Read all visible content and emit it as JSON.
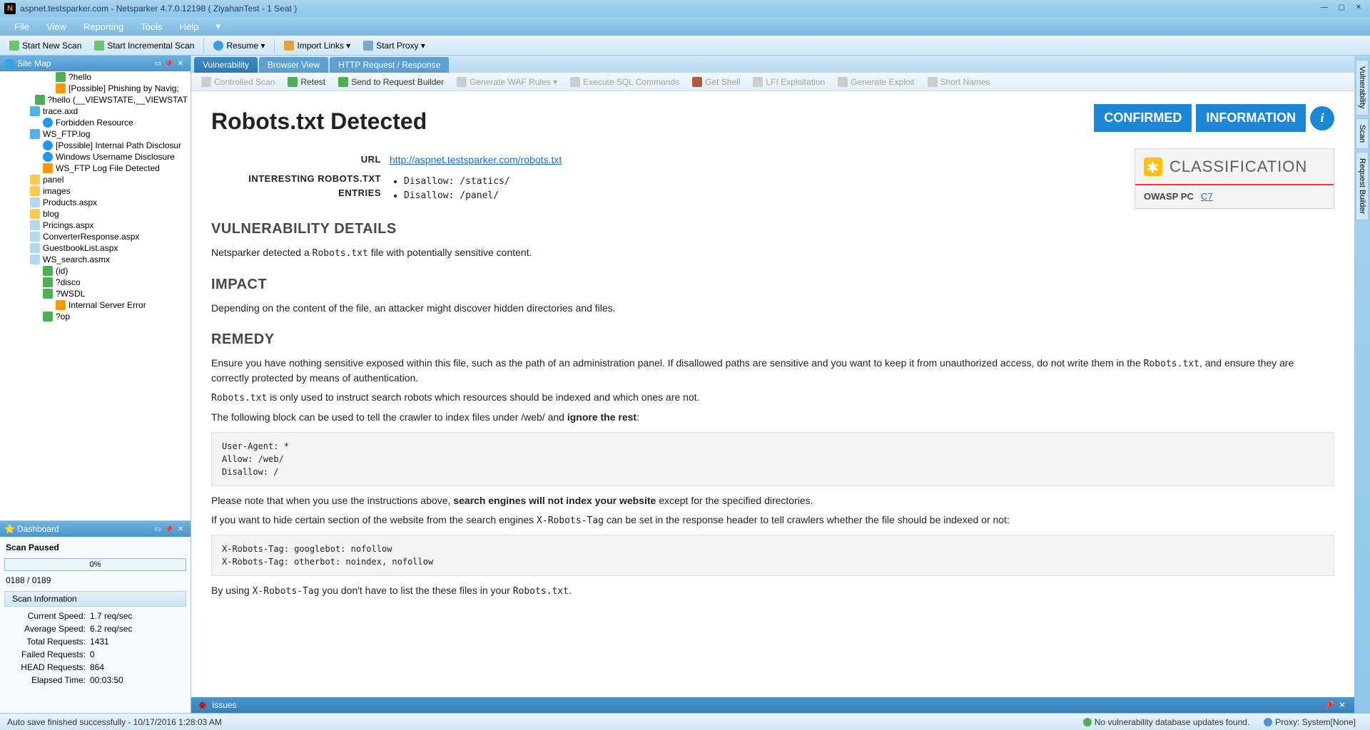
{
  "titlebar": {
    "host": "aspnet.testsparker.com",
    "app": "Netsparker 4.7.0.12198  ( ZiyahanTest - 1 Seat )"
  },
  "menu": {
    "items": [
      "File",
      "View",
      "Reporting",
      "Tools",
      "Help"
    ]
  },
  "toolbar": {
    "start_new_scan": "Start New Scan",
    "start_incremental_scan": "Start Incremental Scan",
    "resume": "Resume",
    "import_links": "Import Links",
    "start_proxy": "Start Proxy"
  },
  "panels": {
    "sitemap_title": "Site Map",
    "dashboard_title": "Dashboard",
    "issues_title": "Issues"
  },
  "sitemap": [
    {
      "indent": 3,
      "icon": "arrow",
      "label": "?hello"
    },
    {
      "indent": 3,
      "icon": "flag",
      "label": "[Possible] Phishing by Navig;"
    },
    {
      "indent": 2,
      "icon": "arrow",
      "label": "?hello (__VIEWSTATE,__VIEWSTAT"
    },
    {
      "indent": 1,
      "icon": "file",
      "label": "trace.axd"
    },
    {
      "indent": 2,
      "icon": "info",
      "label": "Forbidden Resource"
    },
    {
      "indent": 1,
      "icon": "file",
      "label": "WS_FTP.log"
    },
    {
      "indent": 2,
      "icon": "info",
      "label": "[Possible] Internal Path Disclosur"
    },
    {
      "indent": 2,
      "icon": "info",
      "label": "Windows Username Disclosure"
    },
    {
      "indent": 2,
      "icon": "flag",
      "label": "WS_FTP Log File Detected"
    },
    {
      "indent": 1,
      "icon": "folder",
      "label": "panel"
    },
    {
      "indent": 1,
      "icon": "folder",
      "label": "images"
    },
    {
      "indent": 1,
      "icon": "page",
      "label": "Products.aspx"
    },
    {
      "indent": 1,
      "icon": "folder",
      "label": "blog"
    },
    {
      "indent": 1,
      "icon": "page",
      "label": "Pricings.aspx"
    },
    {
      "indent": 1,
      "icon": "page",
      "label": "ConverterResponse.aspx"
    },
    {
      "indent": 1,
      "icon": "page",
      "label": "GuestbookList.aspx"
    },
    {
      "indent": 1,
      "icon": "page",
      "label": "WS_search.asmx"
    },
    {
      "indent": 2,
      "icon": "arrow",
      "label": "(id)"
    },
    {
      "indent": 2,
      "icon": "arrow",
      "label": "?disco"
    },
    {
      "indent": 2,
      "icon": "arrow",
      "label": "?WSDL"
    },
    {
      "indent": 3,
      "icon": "flag",
      "label": "Internal Server Error"
    },
    {
      "indent": 2,
      "icon": "arrow",
      "label": "?op"
    }
  ],
  "dashboard": {
    "status": "Scan Paused",
    "progress": "0%",
    "count": "0188 / 0189",
    "scan_info_title": "Scan Information",
    "stats": [
      {
        "label": "Current Speed:",
        "value": "1.7 req/sec"
      },
      {
        "label": "Average Speed:",
        "value": "6.2 req/sec"
      },
      {
        "label": "Total Requests:",
        "value": "1431"
      },
      {
        "label": "Failed Requests:",
        "value": "0"
      },
      {
        "label": "HEAD Requests:",
        "value": "864"
      },
      {
        "label": "Elapsed Time:",
        "value": "00:03:50"
      }
    ]
  },
  "tabs": {
    "vulnerability": "Vulnerability",
    "browser_view": "Browser View",
    "http_rr": "HTTP Request / Response"
  },
  "subtoolbar": {
    "controlled_scan": "Controlled Scan",
    "retest": "Retest",
    "send_to_rb": "Send to Request Builder",
    "gen_waf": "Generate WAF Rules",
    "exec_sql": "Execute SQL Commands",
    "get_shell": "Get Shell",
    "lfi": "LFI Exploitation",
    "gen_exploit": "Generate Exploit",
    "short_names": "Short Names"
  },
  "report": {
    "title": "Robots.txt Detected",
    "badge_confirmed": "CONFIRMED",
    "badge_info": "INFORMATION",
    "url_label": "URL",
    "url": "http://aspnet.testsparker.com/robots.txt",
    "entries_label": "INTERESTING ROBOTS.TXT ENTRIES",
    "entries": [
      "Disallow: /statics/",
      "Disallow: /panel/"
    ],
    "classification_title": "CLASSIFICATION",
    "class_label": "OWASP PC",
    "class_value": "C7",
    "h_details": "VULNERABILITY DETAILS",
    "p_details_1a": "Netsparker detected a ",
    "p_details_1b": "Robots.txt",
    "p_details_1c": " file with potentially sensitive content.",
    "h_impact": "IMPACT",
    "p_impact": "Depending on the content of the file, an attacker might discover hidden directories and files.",
    "h_remedy": "REMEDY",
    "p_rem1a": "Ensure you have nothing sensitive exposed within this file, such as the path of an administration panel. If disallowed paths are sensitive and you want to keep it from unauthorized access, do not write them in the ",
    "p_rem1b": "Robots.txt",
    "p_rem1c": ", and ensure they are correctly protected by means of authentication.",
    "p_rem2a": "Robots.txt",
    "p_rem2b": " is only used to instruct search robots which resources should be indexed and which ones are not.",
    "p_rem3a": "The following block can be used to tell the crawler to index files under /web/ and ",
    "p_rem3b": "ignore the rest",
    "code1": "User-Agent: *\nAllow: /web/\nDisallow: /",
    "p_rem4a": "Please note that when you use the instructions above, ",
    "p_rem4b": "search engines will not index your website",
    "p_rem4c": " except for the specified directories.",
    "p_rem5a": "If you want to hide certain section of the website from the search engines ",
    "p_rem5b": "X-Robots-Tag",
    "p_rem5c": " can be set in the response header to tell crawlers whether the file should be indexed or not:",
    "code2": "X-Robots-Tag: googlebot: nofollow\nX-Robots-Tag: otherbot: noindex, nofollow",
    "p_rem6a": "By using ",
    "p_rem6b": "X-Robots-Tag",
    "p_rem6c": " you don't have to list the these files in your ",
    "p_rem6d": "Robots.txt",
    "p_rem6e": "."
  },
  "rightstrip": {
    "vulnerability": "Vulnerability",
    "scan": "Scan",
    "request_builder": "Request Builder"
  },
  "statusbar": {
    "autosave": "Auto save finished successfully - 10/17/2016 1:28:03 AM",
    "vulndb": "No vulnerability database updates found.",
    "proxy": "Proxy: System[None]"
  }
}
